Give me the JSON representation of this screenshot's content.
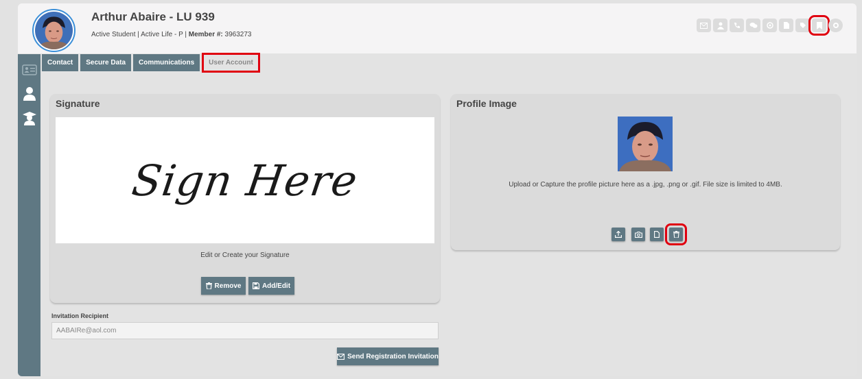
{
  "header": {
    "name": "Arthur Abaire - LU 939",
    "status": "Active Student | Active Life - P | ",
    "member_label": "Member #:",
    "member_number": "3963273",
    "quick_icons": [
      "envelope-icon",
      "user-icon",
      "phone-icon",
      "chat-icon",
      "support-icon",
      "document-icon",
      "tag-icon",
      "bookmark-icon",
      "settings-icon"
    ]
  },
  "sidebar": {
    "items": [
      "id-card-icon",
      "user-icon",
      "graduate-icon"
    ]
  },
  "tabs": [
    {
      "label": "Contact"
    },
    {
      "label": "Secure Data"
    },
    {
      "label": "Communications"
    },
    {
      "label": "User Account"
    }
  ],
  "signature": {
    "title": "Signature",
    "sample_text": "Sign Here",
    "caption": "Edit or Create your Signature",
    "remove_label": "Remove",
    "add_edit_label": "Add/Edit"
  },
  "profile_image": {
    "title": "Profile Image",
    "caption": "Upload or Capture the profile picture here as a .jpg, .png or .gif. File size is limited to 4MB.",
    "actions": [
      "upload-icon",
      "camera-icon",
      "file-icon",
      "trash-icon"
    ]
  },
  "invitation": {
    "label": "Invitation Recipient",
    "value": "AABAIRe@aol.com",
    "send_label": "Send Registration Invitation"
  },
  "colors": {
    "accent": "#5f7883",
    "highlight": "#e00010",
    "avatar_ring": "#3b8fd8"
  }
}
